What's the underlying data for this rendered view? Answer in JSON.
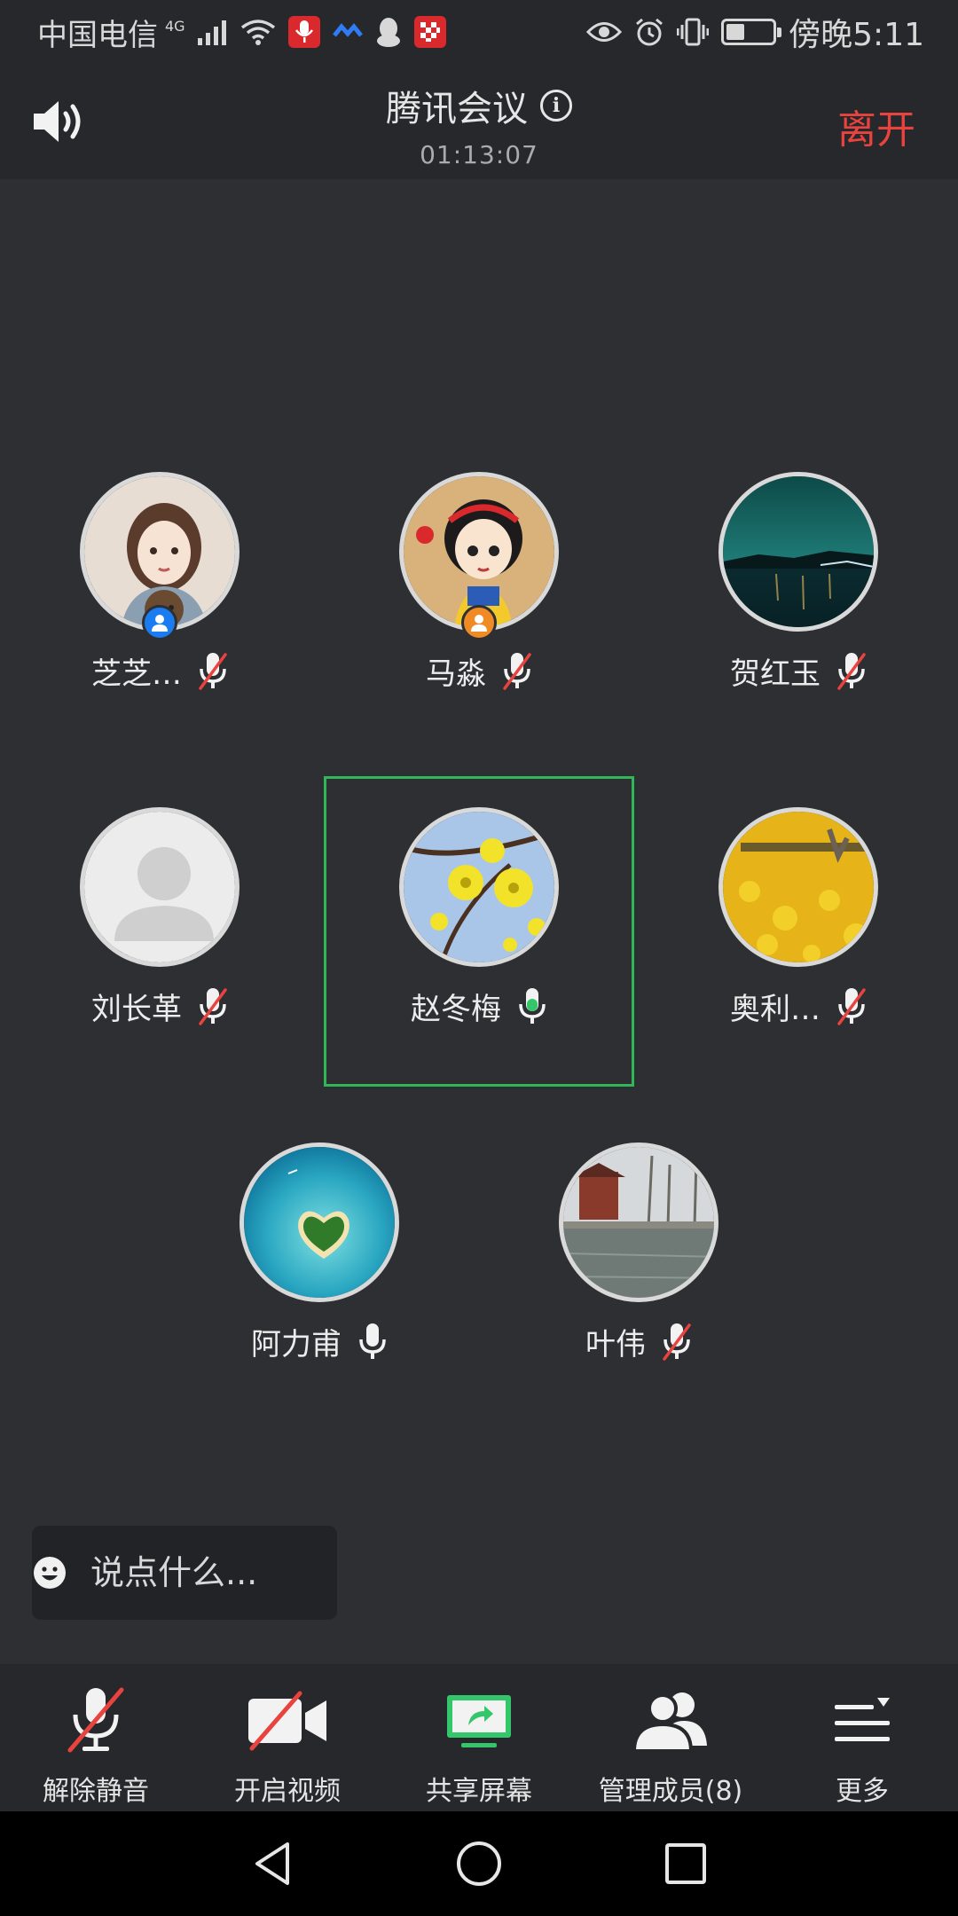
{
  "status_bar": {
    "carrier": "中国电信",
    "network": "4G",
    "time": "傍晚5:11",
    "battery_level": 0.4
  },
  "header": {
    "title": "腾讯会议",
    "duration": "01:13:07",
    "leave_label": "离开"
  },
  "participants": [
    {
      "name": "芝芝…",
      "mic": "muted",
      "badge": "host",
      "avatar": "girl-illustration"
    },
    {
      "name": "马淼",
      "mic": "muted",
      "badge": "cohost",
      "avatar": "cartoon-princess"
    },
    {
      "name": "贺红玉",
      "mic": "muted",
      "badge": null,
      "avatar": "night-lake"
    },
    {
      "name": "刘长革",
      "mic": "muted",
      "badge": null,
      "avatar": "default-person"
    },
    {
      "name": "赵冬梅",
      "mic": "speaking",
      "badge": null,
      "avatar": "yellow-flowers",
      "active": true
    },
    {
      "name": "奥利…",
      "mic": "muted",
      "badge": null,
      "avatar": "yellow-field"
    },
    {
      "name": "阿力甫",
      "mic": "on",
      "badge": null,
      "avatar": "heart-island"
    },
    {
      "name": "叶伟",
      "mic": "muted",
      "badge": null,
      "avatar": "park-pond"
    }
  ],
  "chat": {
    "placeholder": "说点什么..."
  },
  "toolbar": {
    "unmute_label": "解除静音",
    "video_label": "开启视频",
    "share_label": "共享屏幕",
    "members_label": "管理成员(8)",
    "more_label": "更多"
  },
  "colors": {
    "leave": "#e9433f",
    "active_speaker": "#2fb75a",
    "host_badge": "#1a7cf0",
    "cohost_badge": "#f08a24",
    "muted_slash": "#e9433f"
  }
}
